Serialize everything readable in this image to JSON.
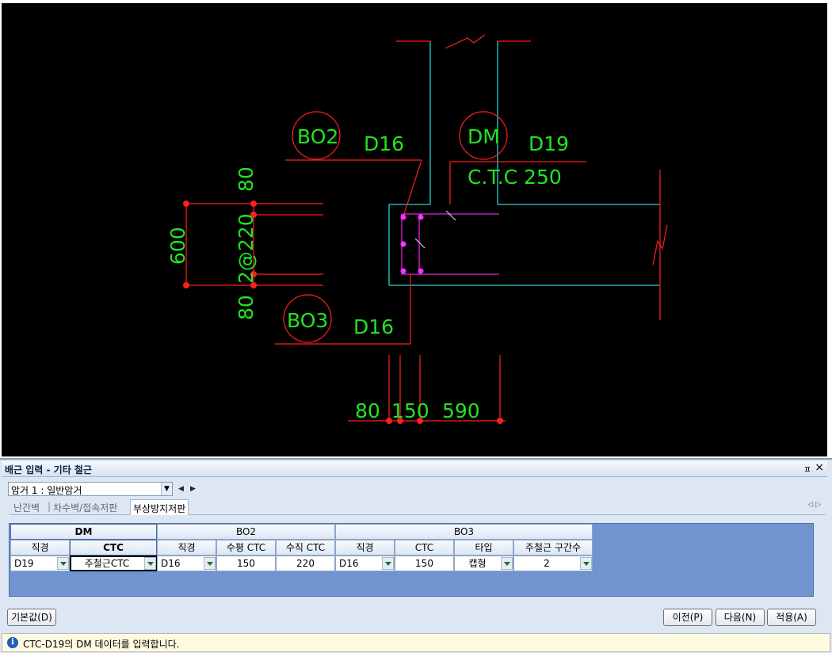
{
  "drawing": {
    "tag_bo2": "BO2",
    "tag_dm": "DM",
    "tag_bo3": "BO3",
    "label_d16_top": "D16",
    "label_d19": "D19",
    "label_ctc250": "C.T.C 250",
    "label_d16_bottom": "D16",
    "dim_600": "600",
    "dim_80_top": "80",
    "dim_2at220": "2@220",
    "dim_80_bottom": "80",
    "dim_80_h": "80",
    "dim_150_h": "150",
    "dim_590_h": "590",
    "colors": {
      "dimension": "#ff1e1e",
      "text": "#22e322",
      "wall": "#28d2d2",
      "rebar": "#e020e0"
    }
  },
  "panel": {
    "title": "배근 입력 - 기타 철근",
    "pin": "ㅍ",
    "close": "×",
    "mode_select": "암거 1 : 일반암거",
    "nav_prev": "◀",
    "nav_next": "▶",
    "tabs": [
      "난간벽",
      "차수벽/접속저판",
      "부상방지저판"
    ],
    "tab_sep": "|",
    "tab_nav": "◁ ▷"
  },
  "table": {
    "group_dm": "DM",
    "group_bo2": "BO2",
    "group_bo3": "BO3",
    "headers": {
      "dm_dia": "직경",
      "dm_ctc": "CTC",
      "bo2_dia": "직경",
      "bo2_hctc": "수평 CTC",
      "bo2_vctc": "수직 CTC",
      "bo3_dia": "직경",
      "bo3_ctc": "CTC",
      "bo3_type": "타입",
      "bo3_count": "주철근 구간수"
    },
    "row": {
      "dm_dia": "D19",
      "dm_ctc": "주철근CTC",
      "bo2_dia": "D16",
      "bo2_hctc": "150",
      "bo2_vctc": "220",
      "bo3_dia": "D16",
      "bo3_ctc": "150",
      "bo3_type": "캡형",
      "bo3_count": "2"
    }
  },
  "buttons": {
    "default": "기본값(D)",
    "prev": "이전(P)",
    "next": "다음(N)",
    "apply": "적용(A)"
  },
  "status": {
    "icon": "i",
    "message": "CTC-D19의 DM 데이터를 입력합니다."
  }
}
